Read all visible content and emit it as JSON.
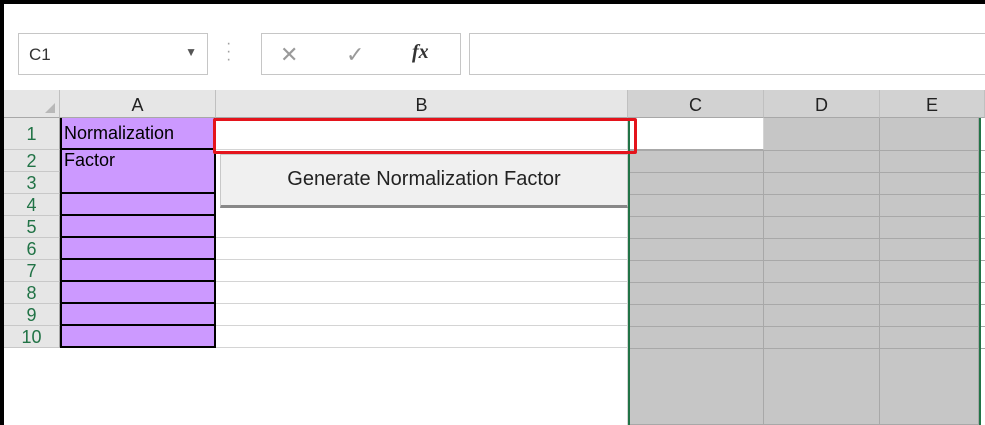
{
  "name_box": {
    "value": "C1",
    "dropdown_icon": "chevron-down-icon"
  },
  "formula_bar": {
    "cancel_icon": "close-icon",
    "enter_icon": "check-icon",
    "function_label": "fx",
    "content": ""
  },
  "columns": [
    "A",
    "B",
    "C",
    "D",
    "E"
  ],
  "rows": [
    "1",
    "2",
    "3",
    "4",
    "5",
    "6",
    "7",
    "8",
    "9",
    "10"
  ],
  "cells": {
    "A1": "Normalization",
    "A2": "Factor",
    "B1": ""
  },
  "button": {
    "label": "Generate Normalization Factor"
  },
  "colors": {
    "purple_fill": "#cc99ff",
    "highlight_red": "#e4141c",
    "selection_green": "#217346",
    "gray_fill": "#c6c6c6"
  }
}
